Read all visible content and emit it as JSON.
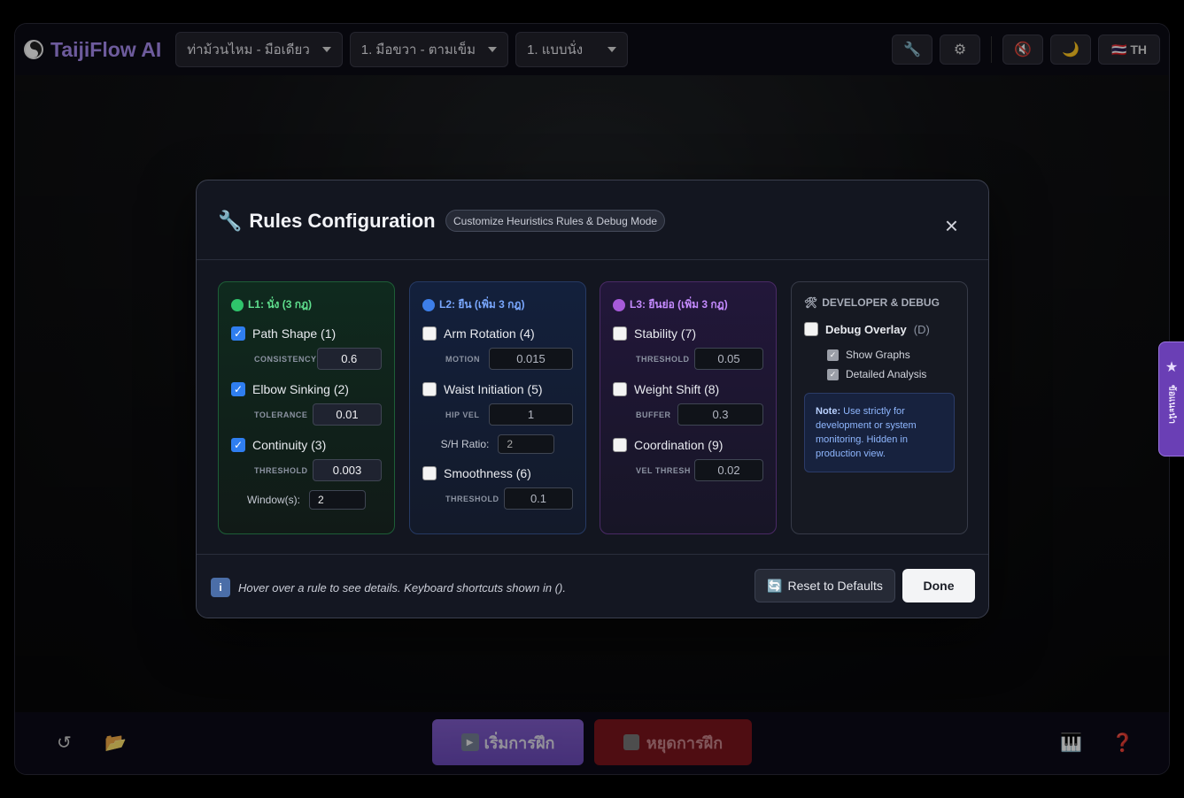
{
  "app": {
    "name": "TaijiFlow AI"
  },
  "topbar": {
    "selects": [
      "ท่าม้วนไหม - มือเดียว",
      "1. มือขวา - ตามเข็ม",
      "1. แบบนั่ง"
    ],
    "tools_icon": "🔧",
    "settings_icon": "⚙",
    "mute_icon": "🔇",
    "theme_icon": "🌙",
    "lang": "🇹🇭 TH"
  },
  "sidetab": {
    "label": "ข้อแนะนำ"
  },
  "bottom": {
    "start": "เริ่มการฝึก",
    "stop": "หยุดการฝึก",
    "reload_icon": "↺",
    "folder_icon": "📂",
    "piano_icon": "🎹",
    "help_icon": "❓"
  },
  "modal": {
    "title": "Rules Configuration",
    "chip": "Customize Heuristics Rules & Debug Mode",
    "close": "×",
    "l1": {
      "title": "L1: นั่ง (3 กฎ)",
      "rules": [
        {
          "label": "Path Shape (1)",
          "param": "CONSISTENCY",
          "value": "0.6"
        },
        {
          "label": "Elbow Sinking (2)",
          "param": "TOLERANCE",
          "value": "0.01"
        },
        {
          "label": "Continuity (3)",
          "param": "THRESHOLD",
          "value": "0.003"
        }
      ],
      "window_label": "Window(s):",
      "window_value": "2"
    },
    "l2": {
      "title": "L2: ยืน (เพิ่ม 3 กฎ)",
      "rules": [
        {
          "label": "Arm Rotation (4)",
          "param": "MOTION",
          "value": "0.015"
        },
        {
          "label": "Waist Initiation (5)",
          "param": "HIP VEL",
          "value": "1"
        },
        {
          "label": "Smoothness (6)",
          "param": "THRESHOLD",
          "value": "0.1"
        }
      ],
      "ratio_label": "S/H Ratio:",
      "ratio_value": "2"
    },
    "l3": {
      "title": "L3: ยืนย่อ (เพิ่ม 3 กฎ)",
      "rules": [
        {
          "label": "Stability (7)",
          "param": "THRESHOLD",
          "value": "0.05"
        },
        {
          "label": "Weight Shift (8)",
          "param": "BUFFER",
          "value": "0.3"
        },
        {
          "label": "Coordination (9)",
          "param": "VEL THRESH",
          "value": "0.02"
        }
      ]
    },
    "dev": {
      "title": "DEVELOPER & DEBUG",
      "overlay_label": "Debug Overlay",
      "overlay_key": "(D)",
      "graphs": "Show Graphs",
      "analysis": "Detailed Analysis",
      "note_bold": "Note:",
      "note_text": " Use strictly for development or system monitoring. Hidden in production view."
    },
    "footer": {
      "hint": "Hover over a rule to see details. Keyboard shortcuts shown in ().",
      "reset": "Reset to Defaults",
      "done": "Done"
    }
  },
  "colors": {
    "accent": "#a88cf0",
    "l1": "#2fc46b",
    "l2": "#3d7ee8",
    "l3": "#a65ad9"
  }
}
